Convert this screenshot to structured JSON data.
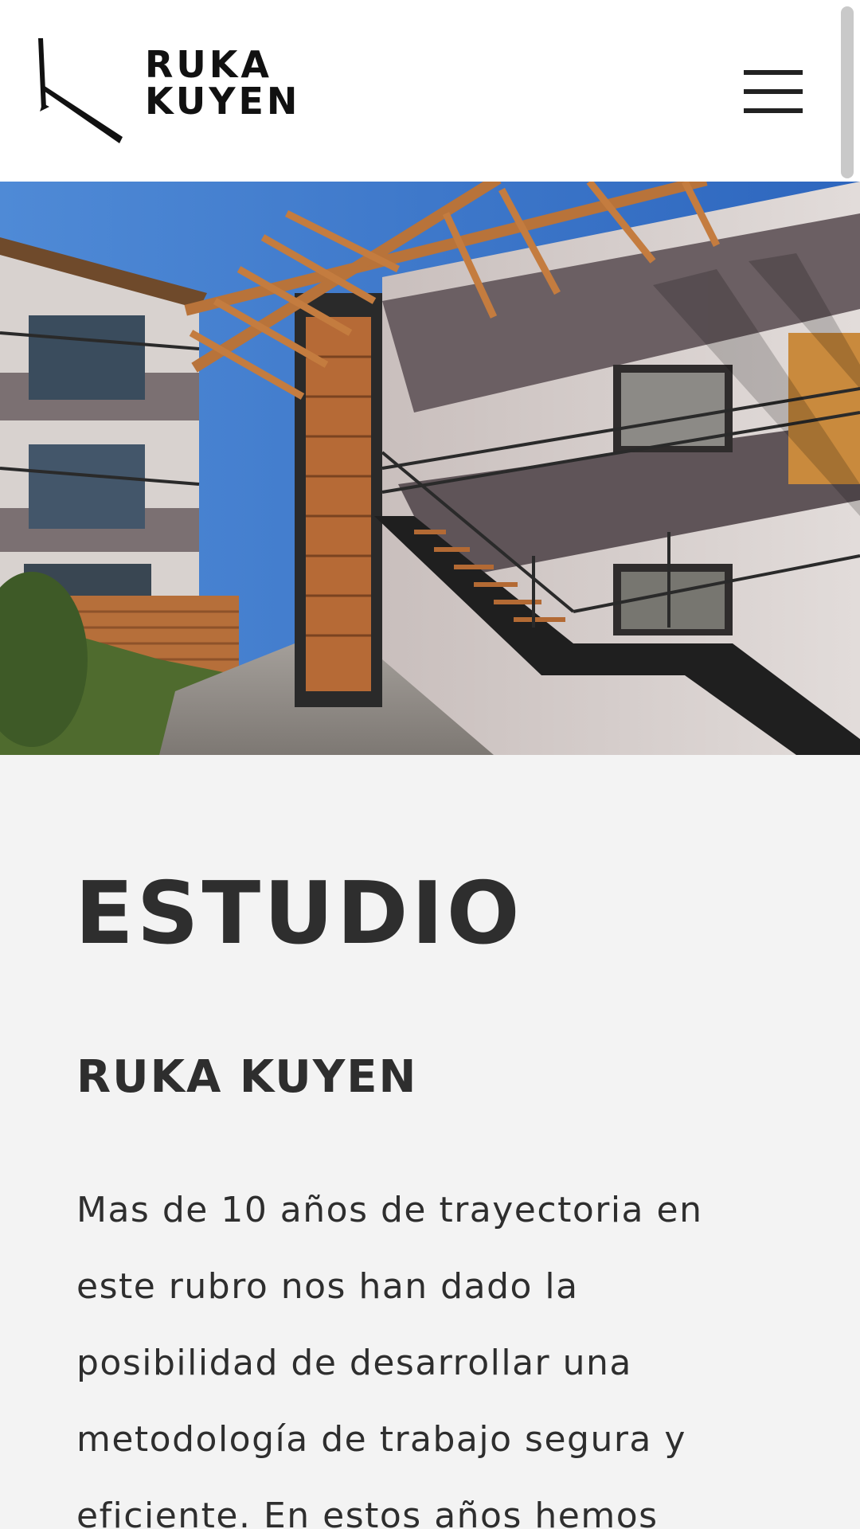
{
  "header": {
    "logo": {
      "icon": "ruka-kuyen-k-logo",
      "line1": "RUKA",
      "line2": "KUYEN"
    },
    "menu_icon": "hamburger-menu-icon"
  },
  "hero": {
    "image": "apartment-building-courtyard-with-wooden-pergola-and-staircases"
  },
  "content": {
    "title": "ESTUDIO",
    "subtitle": "RUKA KUYEN",
    "body": "Mas de 10 años de trayectoria en este rubro nos han dado la posibilidad de desarrollar una metodología de trabajo segura y eficiente. En estos años hemos"
  },
  "colors": {
    "header_bg": "#ffffff",
    "content_bg": "#f3f3f3",
    "text": "#2e2e2e",
    "logo": "#111111"
  }
}
